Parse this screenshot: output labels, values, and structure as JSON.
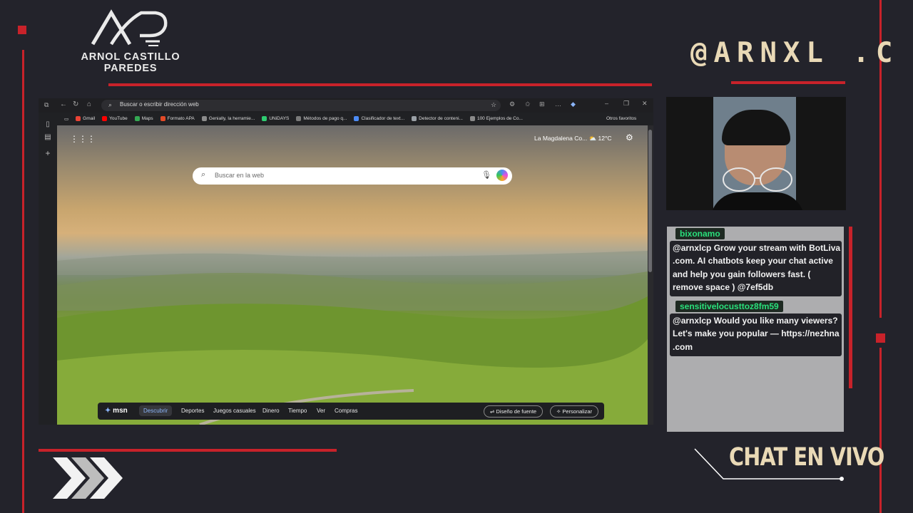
{
  "brand": {
    "logo_name_line1": "ARNOL CASTILLO",
    "logo_name_line2": "PAREDES",
    "handle": "@ARNXL .C",
    "chat_title": "CHAT EN VIVO"
  },
  "colors": {
    "accent_red": "#c8222a",
    "handle_cream": "#e9d9b6",
    "chat_username_green": "#29e07b"
  },
  "browser": {
    "address_placeholder": "Buscar o escribir dirección web",
    "bookmarks": [
      {
        "label": "Gmail",
        "color": "#ea4335"
      },
      {
        "label": "YouTube",
        "color": "#ff0000"
      },
      {
        "label": "Maps",
        "color": "#34a853"
      },
      {
        "label": "Formato APA",
        "color": "#e34a27"
      },
      {
        "label": "Genially, la herramie...",
        "color": "#8c8c8c"
      },
      {
        "label": "UNiDAYS",
        "color": "#2ecc71"
      },
      {
        "label": "Métodos de pago q...",
        "color": "#7a7a7a"
      },
      {
        "label": "Clasificador de text...",
        "color": "#4c8bf5"
      },
      {
        "label": "Detector de conteni...",
        "color": "#9aa0a6"
      },
      {
        "label": "100 Ejemplos de Co...",
        "color": "#8a8a8a"
      }
    ],
    "other_favorites": "Otros favoritos",
    "newtab": {
      "search_placeholder": "Buscar en la web",
      "weather_location": "La Magdalena Co...",
      "weather_temp": "12°C",
      "msn_label": "msn",
      "nav_items": [
        "Descubrir",
        "Deportes",
        "Juegos casuales",
        "Dinero",
        "Tiempo",
        "Ver",
        "Compras"
      ],
      "active_nav": "Descubrir",
      "feed_layout_button": "Diseño de fuente",
      "personalize_button": "Personalizar"
    }
  },
  "chat": {
    "messages": [
      {
        "user": "bixonamo",
        "text": "@arnxlcp Grow your stream with BotLiva .com. AI chatbots keep your chat active and help you gain followers fast. ( remove space ) @7ef5db"
      },
      {
        "user": "sensitivelocusttoz8fm59",
        "text": "@arnxlcp Would you like many viewers? Let's make you popular — https://nezhna .com"
      }
    ]
  }
}
